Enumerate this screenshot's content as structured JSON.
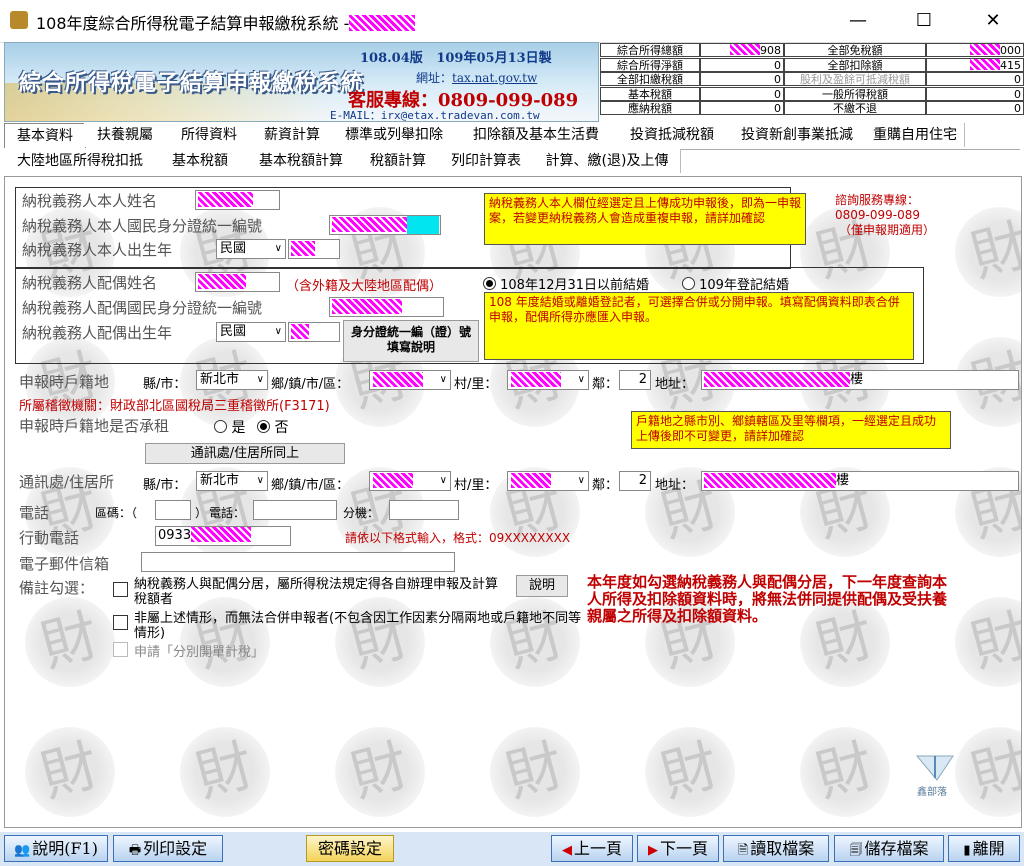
{
  "window": {
    "title": "108年度綜合所得稅電子結算申報繳稅系統 -",
    "minimize": "—",
    "maximize": "☐",
    "close": "✕"
  },
  "banner": {
    "title": "綜合所得稅電子結算申報繳稅系統",
    "version": "108.04版",
    "date": "109年05月13日製",
    "website_label": "網址：",
    "website": "tax.nat.gov.tw",
    "hotline_label": "客服專線：",
    "hotline": "0809-099-089",
    "email": "E-MAIL：irx@etax.tradevan.com.tw"
  },
  "summary": {
    "left": [
      {
        "label": "綜合所得總額",
        "value": "908"
      },
      {
        "label": "綜合所得淨額",
        "value": "0"
      },
      {
        "label": "全部扣繳稅額",
        "value": "0"
      },
      {
        "label": "基本稅額",
        "value": "0"
      },
      {
        "label": "應納稅額",
        "value": "0"
      }
    ],
    "right": [
      {
        "label": "全部免稅額",
        "value": "000"
      },
      {
        "label": "全部扣除額",
        "value": "415"
      },
      {
        "label": "股利及盈餘可抵減稅額",
        "value": "0"
      },
      {
        "label": "一般所得稅額",
        "value": "0"
      },
      {
        "label": "不繳不退",
        "value": "0"
      }
    ]
  },
  "tabs_row1": [
    "基本資料",
    "扶養親屬",
    "所得資料",
    "薪資計算",
    "標準或列舉扣除",
    "扣除額及基本生活費",
    "投資抵減稅額",
    "投資新創事業抵減",
    "重購自用住宅"
  ],
  "tabs_row2": [
    "大陸地區所得稅扣抵",
    "基本稅額",
    "基本稅額計算",
    "稅額計算",
    "列印計算表",
    "計算、繳(退)及上傳"
  ],
  "taxpayer": {
    "name_label": "納稅義務人本人姓名",
    "id_label": "納稅義務人本人國民身分證統一編號",
    "birth_label": "納稅義務人本人出生年",
    "birth_era": "民國",
    "note": "納稅義務人本人欄位經選定且上傳成功申報後，即為一申報案，若變更納稅義務人會造成重複申報，請詳加確認"
  },
  "consult": {
    "line1": "諮詢服務專線：",
    "line2": "0809-099-089",
    "line3": "（僅申報期適用）"
  },
  "spouse": {
    "name_label": "納稅義務人配偶姓名",
    "name_note": "（含外籍及大陸地區配偶）",
    "id_label": "納稅義務人配偶國民身分證統一編號",
    "birth_label": "納稅義務人配偶出生年",
    "birth_era": "民國",
    "id_help_button": "身分證統一編（證）號填寫說明",
    "marriage_opt1": "108年12月31日以前結婚",
    "marriage_opt2": "109年登記結婚",
    "note": "108 年度結婚或離婚登記者，可選擇合併或分開申報。填寫配偶資料即表合併申報，配偶所得亦應匯入申報。"
  },
  "household": {
    "label": "申報時戶籍地",
    "city_label": "縣/市：",
    "city": "新北市",
    "town_label": "鄉/鎮/市/區：",
    "village_label": "村/里：",
    "neighbor_label": "鄰：",
    "neighbor": "2",
    "address_label": "地址：",
    "address_suffix": "樓",
    "office": "所屬稽徵機關：財政部北區國稅局三重稽徵所(F3171)",
    "rent_label": "申報時戶籍地是否承租",
    "rent_yes": "是",
    "rent_no": "否",
    "note": "戶籍地之縣市別、鄉鎮轄區及里等欄項，一經選定且成功上傳後即不可變更，請詳加確認"
  },
  "mailing": {
    "same_button": "通訊處/住居所同上",
    "label": "通訊處/住居所",
    "city_label": "縣/市：",
    "city": "新北市",
    "town_label": "鄉/鎮/市/區：",
    "village_label": "村/里：",
    "neighbor_label": "鄰：",
    "neighbor": "2",
    "address_label": "地址：",
    "address_suffix": "樓"
  },
  "contact": {
    "phone_label": "電話",
    "area_label": "區碼：（",
    "area_close": "）",
    "phone_sub_label": "電話：",
    "ext_label": "分機：",
    "mobile_label": "行動電話",
    "mobile_prefix": "0933",
    "mobile_hint": "請依以下格式輸入，格式：09XXXXXXXX",
    "email_label": "電子郵件信箱"
  },
  "remarks": {
    "label": "備註勾選：",
    "opt1": "納稅義務人與配偶分居，屬所得稅法規定得各自辦理申報及計算稅額者",
    "explain_button": "說明",
    "opt2": "非屬上述情形，而無法合併申報者(不包含因工作因素分隔兩地或戶籍地不同等情形)",
    "opt3": "申請「分別開單計稅」",
    "warning": "本年度如勾選納稅義務人與配偶分居，下一年度查詢本人所得及扣除額資料時，將無法併同提供配偶及受扶養親屬之所得及扣除額資料。"
  },
  "watermark_brand": "鑫部落",
  "bottom": {
    "help": "說明(F1)",
    "print_setup": "列印設定",
    "password": "密碼設定",
    "prev": "上一頁",
    "next": "下一頁",
    "load": "讀取檔案",
    "save": "儲存檔案",
    "exit": "離開"
  }
}
